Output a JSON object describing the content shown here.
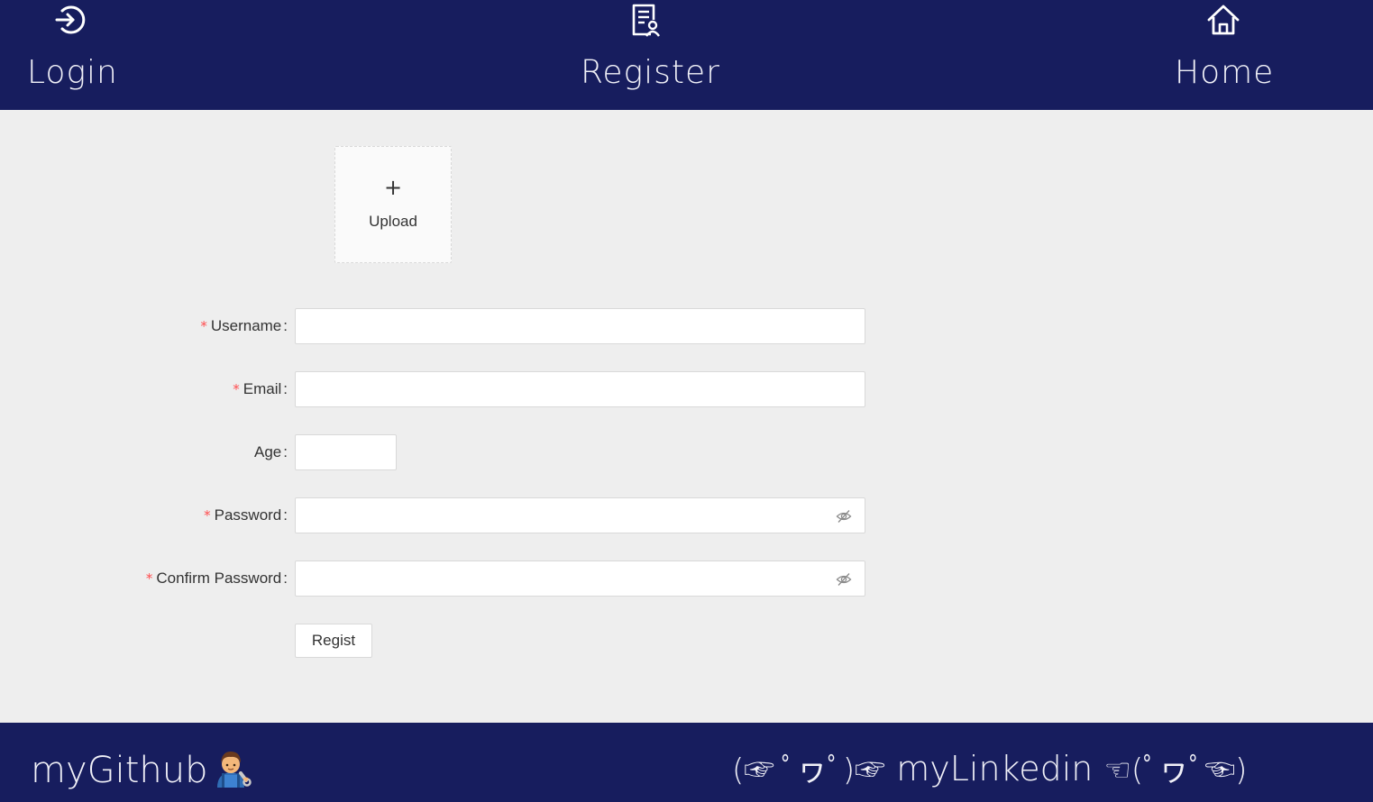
{
  "nav": {
    "items": [
      {
        "id": "login",
        "label": "Login",
        "icon": "login-icon"
      },
      {
        "id": "register",
        "label": "Register",
        "icon": "register-icon"
      },
      {
        "id": "home",
        "label": "Home",
        "icon": "home-icon"
      }
    ]
  },
  "upload": {
    "plus": "+",
    "label": "Upload"
  },
  "form": {
    "fields": [
      {
        "label": "Username",
        "required": true,
        "type": "text",
        "value": ""
      },
      {
        "label": "Email",
        "required": true,
        "type": "email",
        "value": ""
      },
      {
        "label": "Age",
        "required": false,
        "type": "number",
        "value": ""
      },
      {
        "label": "Password",
        "required": true,
        "type": "password",
        "value": "",
        "icon": "eye-invisible-icon"
      },
      {
        "label": "Confirm Password",
        "required": true,
        "type": "password",
        "value": "",
        "icon": "eye-invisible-icon"
      }
    ],
    "required_mark": "*",
    "colon": ":",
    "submit_label": "Regist"
  },
  "footer": {
    "github": {
      "label": "myGithub",
      "emoji": "mechanic-emoji"
    },
    "linkedin": {
      "prefix": "(☞ ﾟヮﾟ)☞",
      "label": " myLinkedin ",
      "suffix": "☜(ﾟヮﾟ☜)"
    }
  },
  "colors": {
    "header_bg": "#171d5e",
    "body_bg": "#eeeeee",
    "required": "#ff4d4f",
    "text": "#333333"
  }
}
